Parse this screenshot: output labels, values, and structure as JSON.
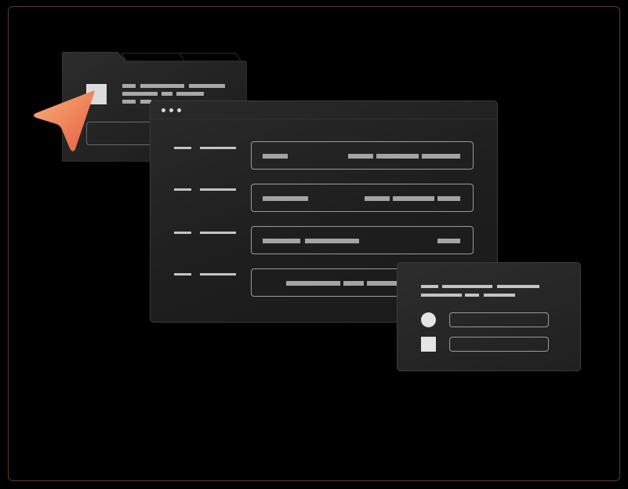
{
  "scene": {
    "accent": "#f08a5d",
    "accent_gradient": [
      "#f4a46b",
      "#e86a4a"
    ],
    "background": "#000000",
    "frame_border": "#5a3a36",
    "card_background": "#222222",
    "placeholder_color": "#a8a8a8"
  },
  "icons": {
    "cursor": "pointer-arrow-icon",
    "window_dots": "window-controls-icon",
    "radio": "circle-icon",
    "checkbox": "square-icon"
  },
  "content": {
    "text": []
  }
}
